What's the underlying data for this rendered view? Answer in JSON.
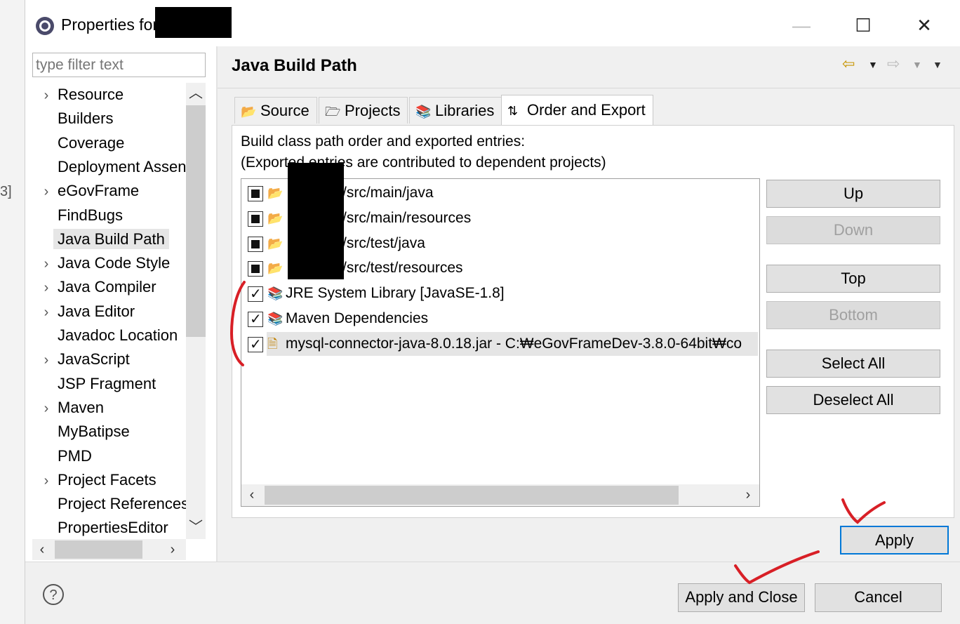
{
  "window": {
    "title": "Properties for",
    "minimize_label": "—",
    "maximize_label": "☐",
    "close_label": "✕"
  },
  "sidebar": {
    "filter_placeholder": "type filter text",
    "items": [
      {
        "label": "Resource",
        "expandable": true
      },
      {
        "label": "Builders",
        "expandable": false
      },
      {
        "label": "Coverage",
        "expandable": false
      },
      {
        "label": "Deployment Assen",
        "expandable": false
      },
      {
        "label": "eGovFrame",
        "expandable": true
      },
      {
        "label": "FindBugs",
        "expandable": false
      },
      {
        "label": "Java Build Path",
        "expandable": false,
        "selected": true
      },
      {
        "label": "Java Code Style",
        "expandable": true
      },
      {
        "label": "Java Compiler",
        "expandable": true
      },
      {
        "label": "Java Editor",
        "expandable": true
      },
      {
        "label": "Javadoc Location",
        "expandable": false
      },
      {
        "label": "JavaScript",
        "expandable": true
      },
      {
        "label": "JSP Fragment",
        "expandable": false
      },
      {
        "label": "Maven",
        "expandable": true
      },
      {
        "label": "MyBatipse",
        "expandable": false
      },
      {
        "label": "PMD",
        "expandable": false
      },
      {
        "label": "Project Facets",
        "expandable": true
      },
      {
        "label": "Project References",
        "expandable": false
      },
      {
        "label": "PropertiesEditor",
        "expandable": false
      }
    ]
  },
  "main": {
    "page_title": "Java Build Path",
    "tabs": [
      {
        "label": "Source",
        "icon": "source-folder-icon"
      },
      {
        "label": "Projects",
        "icon": "projects-folder-icon"
      },
      {
        "label": "Libraries",
        "icon": "libraries-icon"
      },
      {
        "label": "Order and Export",
        "icon": "order-export-icon",
        "active": true
      }
    ],
    "description_line1": "Build class path order and exported entries:",
    "description_line2": "(Exported entries are contributed to dependent projects)",
    "entries": [
      {
        "label": "/src/main/java",
        "state": "partial",
        "icon": "package-folder-icon"
      },
      {
        "label": "/src/main/resources",
        "state": "partial",
        "icon": "package-folder-icon"
      },
      {
        "label": "/src/test/java",
        "state": "partial",
        "icon": "package-folder-icon"
      },
      {
        "label": "/src/test/resources",
        "state": "partial",
        "icon": "package-folder-icon"
      },
      {
        "label": "JRE System Library [JavaSE-1.8]",
        "state": "checked",
        "icon": "library-icon"
      },
      {
        "label": "Maven Dependencies",
        "state": "checked",
        "icon": "library-icon"
      },
      {
        "label": "mysql-connector-java-8.0.18.jar - C:₩eGovFrameDev-3.8.0-64bit₩co",
        "state": "checked",
        "icon": "jar-icon",
        "selected": true
      }
    ],
    "buttons": {
      "up": "Up",
      "down": "Down",
      "top": "Top",
      "bottom": "Bottom",
      "select_all": "Select All",
      "deselect_all": "Deselect All"
    },
    "apply": "Apply"
  },
  "footer": {
    "help": "?",
    "apply_and_close": "Apply and Close",
    "cancel": "Cancel"
  },
  "colors": {
    "accent": "#0078d7",
    "annotation": "#d81f26",
    "selection": "#e5e5e5",
    "panel_bg": "#f0f0f0"
  }
}
